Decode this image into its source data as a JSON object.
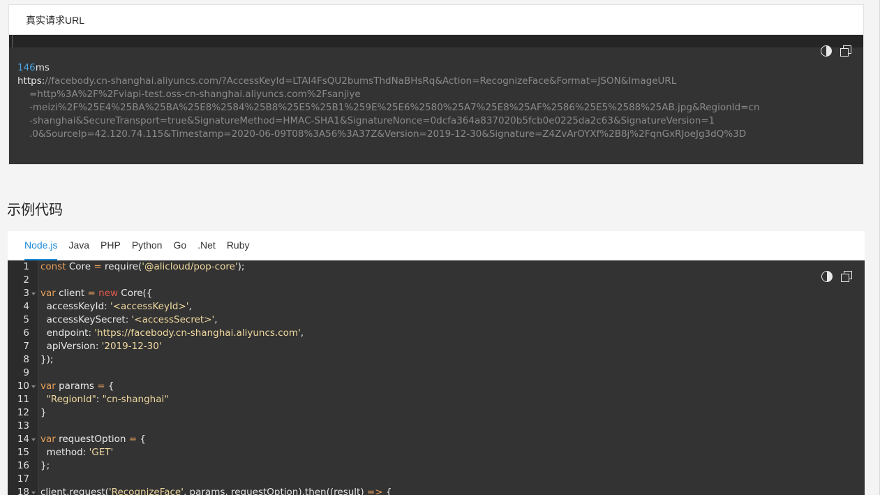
{
  "url_panel": {
    "tab_label": "真实请求URL",
    "ms_value": "146",
    "ms_unit": "ms",
    "url_protocol": "https:",
    "url_line1": "//facebody.cn-shanghai.aliyuncs.com/?AccessKeyId=LTAI4FsQU2bumsThdNaBHsRq&Action=RecognizeFace&Format=JSON&ImageURL",
    "url_line2": "=http%3A%2F%2Fviapi-test.oss-cn-shanghai.aliyuncs.com%2Fsanjiye",
    "url_line3": "-meizi%2F%25E4%25BA%25BA%25E8%2584%25B8%25E5%25B1%259E%25E6%2580%25A7%25E8%25AF%2586%25E5%2588%25AB.jpg&RegionId=cn",
    "url_line4": "-shanghai&SecureTransport=true&SignatureMethod=HMAC-SHA1&SignatureNonce=0dcfa364a837020b5fcb0e0225da2c63&SignatureVersion=1",
    "url_line5": ".0&SourceIp=42.120.74.115&Timestamp=2020-06-09T08%3A56%3A37Z&Version=2019-12-30&Signature=Z4ZvArOYXf%2B8j%2FqnGxRJoeJg3dQ%3D",
    "icons": [
      "contrast-icon",
      "copy-icon"
    ]
  },
  "section": {
    "title": "示例代码"
  },
  "code_panel": {
    "tabs": [
      "Node.js",
      "Java",
      "PHP",
      "Python",
      "Go",
      ".Net",
      "Ruby"
    ],
    "active_tab": "Node.js",
    "line_numbers": [
      "1",
      "2",
      "3",
      "4",
      "5",
      "6",
      "7",
      "8",
      "9",
      "10",
      "11",
      "12",
      "13",
      "14",
      "15",
      "16",
      "17",
      "18"
    ],
    "lines": [
      "const Core = require('@alicloud/pop-core');",
      "",
      "var client = new Core({",
      "  accessKeyId: '<accessKeyId>',",
      "  accessKeySecret: '<accessSecret>',",
      "  endpoint: 'https://facebody.cn-shanghai.aliyuncs.com',",
      "  apiVersion: '2019-12-30'",
      "});",
      "",
      "var params = {",
      "  \"RegionId\": \"cn-shanghai\"",
      "}",
      "",
      "var requestOption = {",
      "  method: 'GET'",
      "};",
      "",
      "client.request('RecognizeFace', params, requestOption).then((result) => {"
    ],
    "fold_lines": [
      "3",
      "10",
      "14",
      "18"
    ]
  }
}
